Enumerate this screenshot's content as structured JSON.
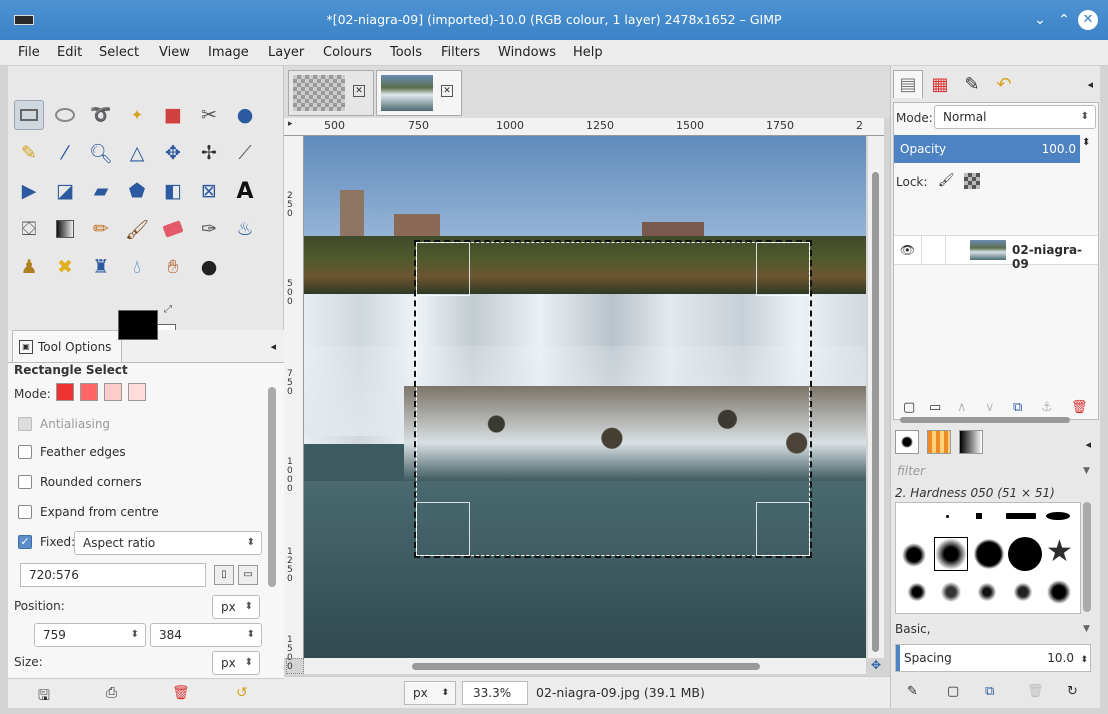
{
  "window": {
    "title": "*[02-niagra-09] (imported)-10.0 (RGB colour, 1 layer) 2478x1652 – GIMP",
    "minimize": "⌄",
    "maximize": "⌃",
    "close": "✕"
  },
  "menu": [
    "File",
    "Edit",
    "Select",
    "View",
    "Image",
    "Layer",
    "Colours",
    "Tools",
    "Filters",
    "Windows",
    "Help"
  ],
  "toolbox": {
    "tools": [
      "rect-select-icon",
      "ellipse-select-icon",
      "free-select-icon",
      "fuzzy-select-icon",
      "color-select-icon",
      "scissors-select-icon",
      "foreground-select-icon",
      "paths-icon",
      "color-picker-icon",
      "zoom-icon",
      "measure-icon",
      "move-icon",
      "align-icon",
      "crop-icon",
      "rotate-icon",
      "scale-icon",
      "shear-icon",
      "perspective-icon",
      "flip-icon",
      "cage-transform-icon",
      "text-icon",
      "bucket-fill-icon",
      "blend-icon",
      "pencil-icon",
      "paintbrush-icon",
      "eraser-icon",
      "airbrush-icon",
      "ink-icon",
      "clone-icon",
      "heal-icon",
      "perspective-clone-icon",
      "blur-icon",
      "smudge-icon",
      "dodge-burn-icon"
    ],
    "foreground_color": "#000000",
    "background_color": "#ffffff"
  },
  "tool_options": {
    "tab_label": "Tool Options",
    "title": "Rectangle Select",
    "mode_label": "Mode:",
    "antialiasing": "Antialiasing",
    "feather_edges": "Feather edges",
    "rounded_corners": "Rounded corners",
    "expand_from_centre": "Expand from centre",
    "fixed_label": "Fixed:",
    "fixed_value": "Aspect ratio",
    "ratio_value": "720:576",
    "position_label": "Position:",
    "position_unit": "px",
    "position_x": "759",
    "position_y": "384",
    "size_label": "Size:",
    "size_unit": "px"
  },
  "image_tabs": [
    {
      "name": "image-thumbnail-1"
    },
    {
      "name": "image-thumbnail-2"
    }
  ],
  "ruler": {
    "top_labels": [
      "500",
      "750",
      "1000",
      "1250",
      "1500",
      "1750",
      "2"
    ],
    "left_labels": [
      "250",
      "500",
      "750",
      "1000",
      "1250",
      "1500"
    ]
  },
  "status": {
    "unit": "px",
    "zoom": "33.3%",
    "message": "02-niagra-09.jpg (39.1 MB)"
  },
  "layers": {
    "mode_label": "Mode:",
    "mode_value": "Normal",
    "opacity_label": "Opacity",
    "opacity_value": "100.0",
    "lock_label": "Lock:",
    "layer_name": "02-niagra-09"
  },
  "brushes": {
    "filter_placeholder": "filter",
    "current_brush": "2. Hardness 050 (51 × 51)",
    "preset": "Basic,",
    "spacing_label": "Spacing",
    "spacing_value": "10.0"
  }
}
